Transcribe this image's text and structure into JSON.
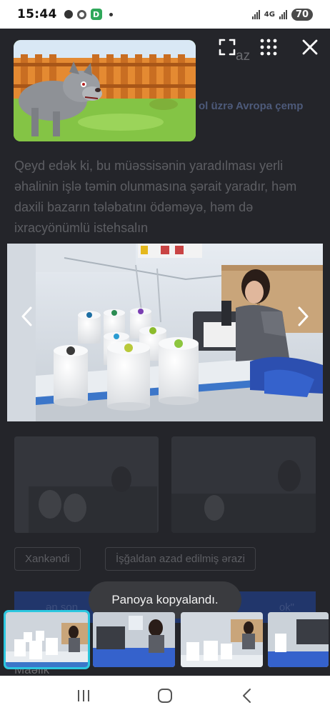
{
  "status_bar": {
    "time": "15:44",
    "app_badge": "D",
    "network": "4G",
    "battery": "70"
  },
  "background_page": {
    "top_right_text": "az",
    "subtitle_text": "ol üzrə Avropa çemp",
    "paragraph": "Qeyd edək ki, bu müəssisənin yaradılması yerli əhalinin işlə təmin olunmasına şərait yaradır, həm daxili bazarın tələbatını ödəməyə, həm də ixracyönümlü istehsalın",
    "tags": [
      "Xankəndi",
      "İşğaldan azad edilmiş ərazi"
    ],
    "banner_left": "ən son",
    "banner_right": "ok\"",
    "bottom_text": "Maəlik"
  },
  "toast": {
    "text": "Panoya kopyalandı."
  },
  "viewer": {
    "prev_icon": "chevron-left-icon",
    "next_icon": "chevron-right-icon",
    "fullscreen_icon": "fullscreen-icon",
    "grid_icon": "grid-icon",
    "close_icon": "close-icon",
    "selected_index": 0
  },
  "colors": {
    "accent": "#2cc7df",
    "dim_background": "#24252a",
    "toast_background": "#3a3b3f"
  }
}
